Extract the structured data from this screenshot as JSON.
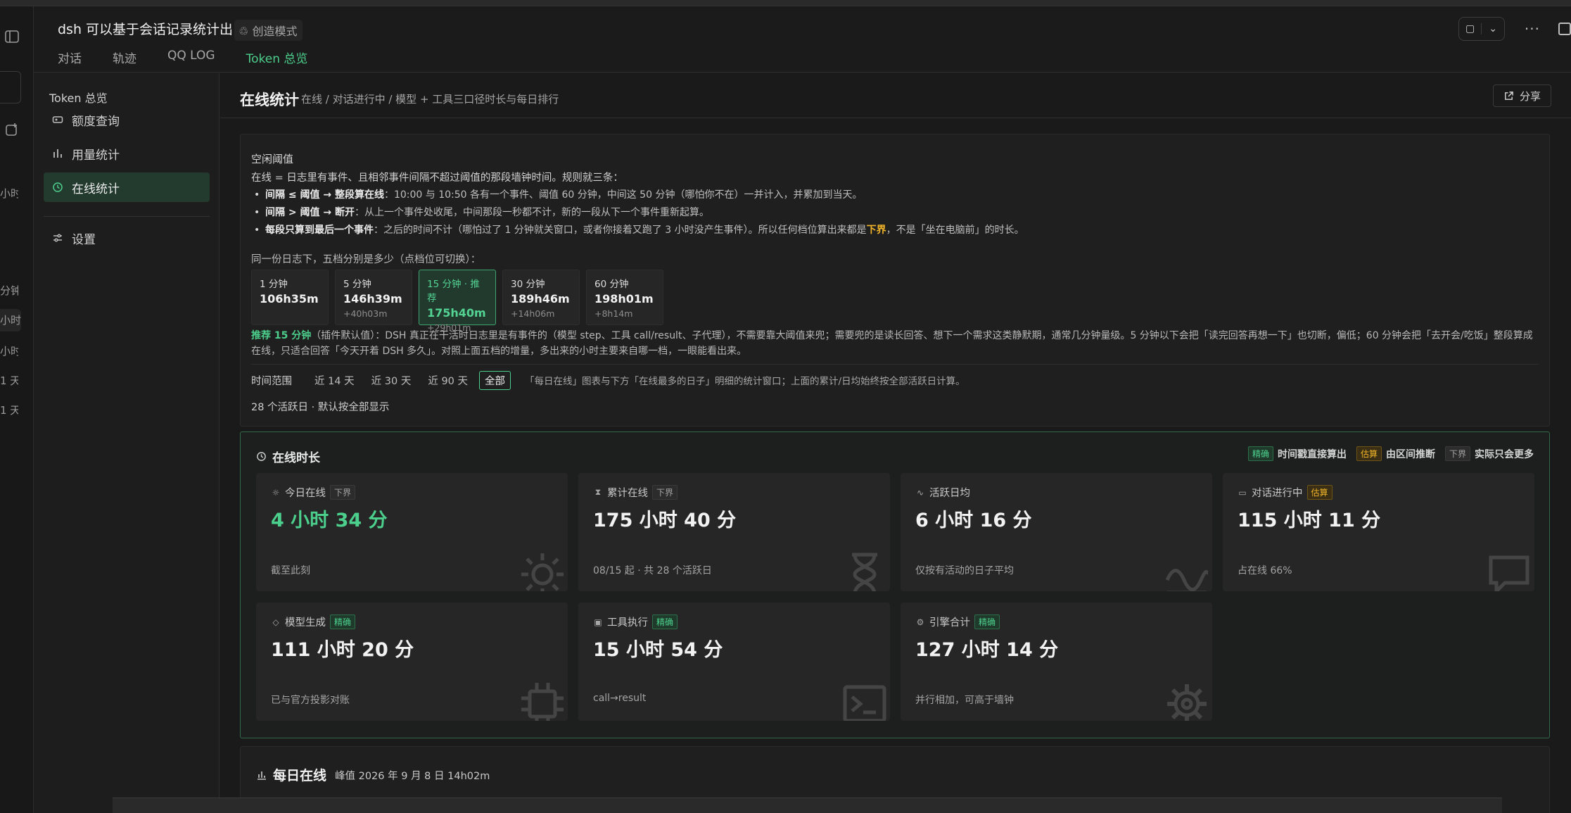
{
  "header": {
    "title": "dsh 可以基于会话记录统计出",
    "mode": "创造模式",
    "tabs": [
      {
        "label": "对话"
      },
      {
        "label": "轨迹"
      },
      {
        "label": "QQ LOG"
      },
      {
        "label": "Token 总览"
      }
    ],
    "active_tab": "Token 总览",
    "more_label": "···"
  },
  "rail": {
    "labels": [
      "小时",
      "分钟",
      "小时",
      "小时",
      "1 天",
      "1 天"
    ]
  },
  "sidebar": {
    "title": "Token 总览",
    "items": [
      {
        "label": "额度查询",
        "icon": "card-icon"
      },
      {
        "label": "用量统计",
        "icon": "bar-chart-icon"
      },
      {
        "label": "在线统计",
        "icon": "clock-icon"
      },
      {
        "label": "设置",
        "icon": "sliders-icon"
      }
    ],
    "active": "在线统计"
  },
  "page": {
    "title": "在线统计",
    "subtitle": "在线 / 对话进行中 / 模型 + 工具三口径时长与每日排行",
    "share_label": "分享"
  },
  "threshold": {
    "label": "空闲阈值",
    "intro": "在线 = 日志里有事件、且相邻事件间隔不超过阈值的那段墙钟时间。规则就三条：",
    "rules": [
      {
        "bold": "间隔 ≤ 阈值 → 整段算在线",
        "text": "：10:00 与 10:50 各有一个事件、阈值 60 分钟，中间这 50 分钟（哪怕你不在）一并计入，并累加到当天。"
      },
      {
        "bold": "间隔 > 阈值 → 断开",
        "text": "：从上一个事件处收尾，中间那段一秒都不计，新的一段从下一个事件重新起算。"
      },
      {
        "bold": "每段只算到最后一个事件",
        "text": "：之后的时间不计（哪怕过了 1 分钟就关窗口，或者你接着又跑了 3 小时没产生事件）。所以任何档位算出来都是",
        "highlight": "下界",
        "tail": "，不是「坐在电脑前」的时长。"
      }
    ],
    "question": "同一份日志下，五档分别是多少（点档位可切换）：",
    "options": [
      {
        "label": "1 分钟",
        "value": "106h35m",
        "delta": ""
      },
      {
        "label": "5 分钟",
        "value": "146h39m",
        "delta": "+40h03m"
      },
      {
        "label": "15 分钟 · 推荐",
        "value": "175h40m",
        "delta": "+29h01m"
      },
      {
        "label": "30 分钟",
        "value": "189h46m",
        "delta": "+14h06m"
      },
      {
        "label": "60 分钟",
        "value": "198h01m",
        "delta": "+8h14m"
      }
    ],
    "active_option": 2,
    "recommend_bold": "推荐 15 分钟",
    "recommend_text": "（插件默认值）：DSH 真正在干活时日志里是有事件的（模型 step、工具 call/result、子代理），不需要靠大阈值来兜；需要兜的是读长回答、想下一个需求这类静默期，通常几分钟量级。5 分钟以下会把「读完回答再想一下」也切断，偏低；60 分钟会把「去开会/吃饭」整段算成在线，只适合回答「今天开着 DSH 多久」。对照上面五档的增量，多出来的小时主要来自哪一档，一眼能看出来。"
  },
  "range": {
    "label": "时间范围",
    "options": [
      "近 14 天",
      "近 30 天",
      "近 90 天",
      "全部"
    ],
    "active": "全部",
    "hint": "「每日在线」图表与下方「在线最多的日子」明细的统计窗口；上面的累计/日均始终按全部活跃日计算。",
    "active_days": "28 个活跃日 · 默认按全部显示"
  },
  "online": {
    "title": "在线时长",
    "legend": [
      {
        "tag": "精确",
        "text": "时间戳直接算出",
        "style": "g"
      },
      {
        "tag": "估算",
        "text": "由区间推断",
        "style": "o"
      },
      {
        "tag": "下界",
        "text": "实际只会更多",
        "style": "n"
      }
    ],
    "cards": [
      {
        "label": "今日在线",
        "tag": "下界",
        "tag_style": "n",
        "value": "4 小时 34 分",
        "foot": "截至此刻",
        "icon": "sun-icon"
      },
      {
        "label": "累计在线",
        "tag": "下界",
        "tag_style": "n",
        "value": "175 小时 40 分",
        "foot": "08/15 起 · 共 28 个活跃日",
        "icon": "hourglass-icon"
      },
      {
        "label": "活跃日均",
        "tag": "",
        "tag_style": "",
        "value": "6 小时 16 分",
        "foot": "仅按有活动的日子平均",
        "icon": "wave-icon"
      },
      {
        "label": "对话进行中",
        "tag": "估算",
        "tag_style": "o",
        "value": "115 小时 11 分",
        "foot": "占在线 66%",
        "icon": "chat-icon"
      },
      {
        "label": "模型生成",
        "tag": "精确",
        "tag_style": "g",
        "value": "111 小时 20 分",
        "foot": "已与官方投影对账",
        "icon": "chip-icon"
      },
      {
        "label": "工具执行",
        "tag": "精确",
        "tag_style": "g",
        "value": "15 小时 54 分",
        "foot": "call→result",
        "icon": "terminal-icon"
      },
      {
        "label": "引擎合计",
        "tag": "精确",
        "tag_style": "g",
        "value": "127 小时 14 分",
        "foot": "并行相加，可高于墙钟",
        "icon": "gear-icon"
      }
    ]
  },
  "daily": {
    "title": "每日在线",
    "peak": "峰值 2026 年 9 月 8 日 14h02m"
  }
}
